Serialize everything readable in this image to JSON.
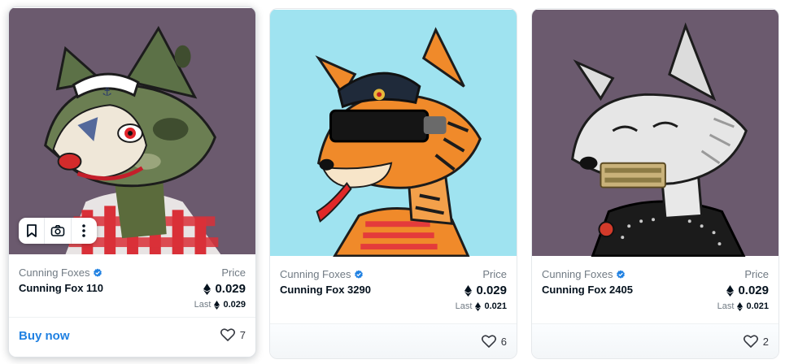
{
  "price_label": "Price",
  "last_label": "Last",
  "buy_now_label": "Buy now",
  "cards": [
    {
      "collection": "Cunning Foxes",
      "name": "Cunning Fox 110",
      "price": "0.029",
      "last_price": "0.029",
      "likes": "7",
      "background": "#6b5a6e"
    },
    {
      "collection": "Cunning Foxes",
      "name": "Cunning Fox 3290",
      "price": "0.029",
      "last_price": "0.021",
      "likes": "6",
      "background": "#9fe3f0"
    },
    {
      "collection": "Cunning Foxes",
      "name": "Cunning Fox 2405",
      "price": "0.029",
      "last_price": "0.021",
      "likes": "2",
      "background": "#6b5a6e"
    }
  ],
  "colors": {
    "accent": "#2081e2",
    "verified": "#2081e2",
    "muted": "#707a83"
  },
  "icons": [
    "bookmark-icon",
    "camera-icon",
    "more-vertical-icon",
    "heart-icon",
    "ethereum-icon",
    "verified-badge-icon"
  ]
}
